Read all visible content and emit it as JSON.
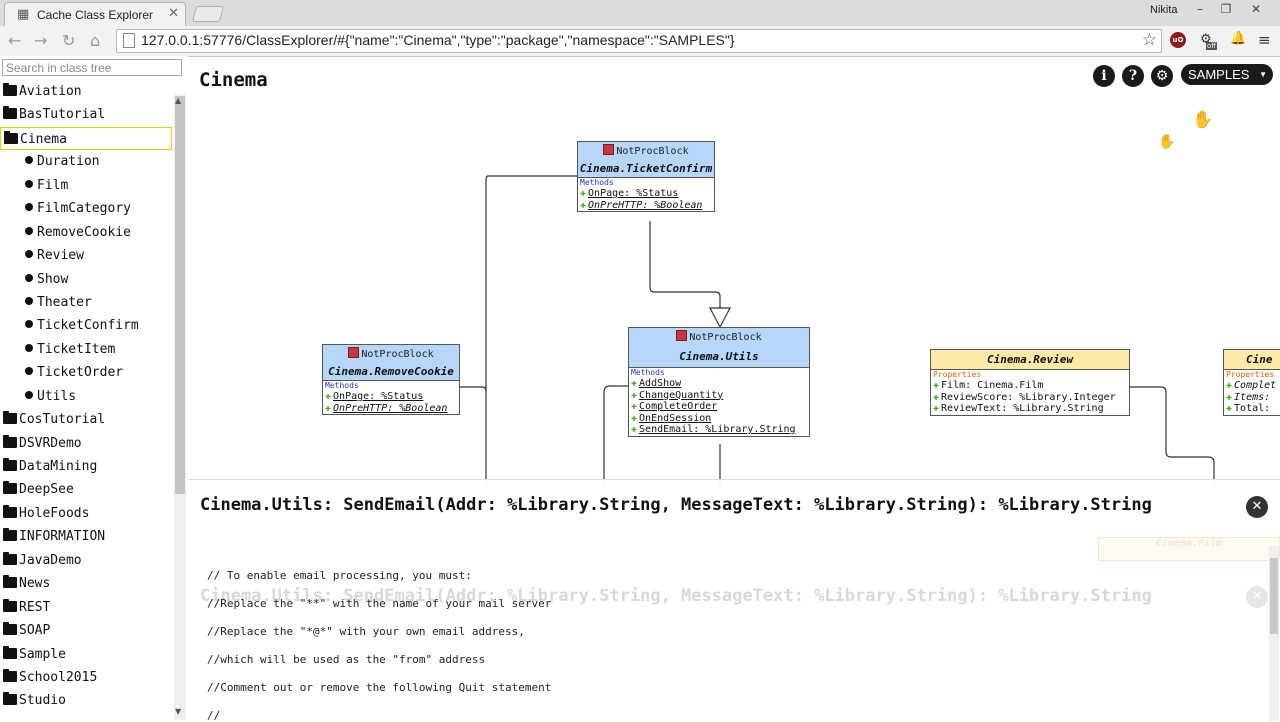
{
  "browser": {
    "tab_title": "Cache Class Explorer",
    "user_name": "Nikita",
    "url": "127.0.0.1:57776/ClassExplorer/#{\"name\":\"Cinema\",\"type\":\"package\",\"namespace\":\"SAMPLES\"}",
    "extensions": {
      "ublock_label": "uO",
      "off_badge": "off"
    },
    "icons": [
      "back-icon",
      "forward-icon",
      "reload-icon",
      "home-icon",
      "star-icon",
      "bell-icon",
      "menu-icon"
    ]
  },
  "sidebar": {
    "search_placeholder": "Search in class tree",
    "items": [
      {
        "label": "Aviation",
        "kind": "package"
      },
      {
        "label": "BasTutorial",
        "kind": "package"
      },
      {
        "label": "Cinema",
        "kind": "package",
        "selected": true
      },
      {
        "label": "Duration",
        "kind": "class"
      },
      {
        "label": "Film",
        "kind": "class"
      },
      {
        "label": "FilmCategory",
        "kind": "class"
      },
      {
        "label": "RemoveCookie",
        "kind": "class"
      },
      {
        "label": "Review",
        "kind": "class"
      },
      {
        "label": "Show",
        "kind": "class"
      },
      {
        "label": "Theater",
        "kind": "class"
      },
      {
        "label": "TicketConfirm",
        "kind": "class"
      },
      {
        "label": "TicketItem",
        "kind": "class"
      },
      {
        "label": "TicketOrder",
        "kind": "class"
      },
      {
        "label": "Utils",
        "kind": "class"
      },
      {
        "label": "CosTutorial",
        "kind": "package"
      },
      {
        "label": "DSVRDemo",
        "kind": "package"
      },
      {
        "label": "DataMining",
        "kind": "package"
      },
      {
        "label": "DeepSee",
        "kind": "package"
      },
      {
        "label": "HoleFoods",
        "kind": "package"
      },
      {
        "label": "INFORMATION",
        "kind": "package"
      },
      {
        "label": "JavaDemo",
        "kind": "package"
      },
      {
        "label": "News",
        "kind": "package"
      },
      {
        "label": "REST",
        "kind": "package"
      },
      {
        "label": "SOAP",
        "kind": "package"
      },
      {
        "label": "Sample",
        "kind": "package"
      },
      {
        "label": "School2015",
        "kind": "package"
      },
      {
        "label": "Studio",
        "kind": "package"
      }
    ]
  },
  "main": {
    "title": "Cinema",
    "info_label": "i",
    "help_label": "?",
    "namespace": "SAMPLES"
  },
  "diagram": {
    "ticket_confirm": {
      "stereotype": "NotProcBlock",
      "name": "Cinema.TicketConfirm",
      "section": "Methods",
      "rows": [
        "OnPage: %Status",
        "OnPreHTTP: %Boolean"
      ]
    },
    "remove_cookie": {
      "stereotype": "NotProcBlock",
      "name": "Cinema.RemoveCookie",
      "section": "Methods",
      "rows": [
        "OnPage: %Status",
        "OnPreHTTP: %Boolean"
      ]
    },
    "utils": {
      "stereotype": "NotProcBlock",
      "name": "Cinema.Utils",
      "section": "Methods",
      "rows": [
        "AddShow",
        "ChangeQuantity",
        "CompleteOrder",
        "OnEndSession",
        "SendEmail: %Library.String"
      ]
    },
    "review": {
      "name": "Cinema.Review",
      "section": "Properties",
      "rows": [
        "Film: Cinema.Film",
        "ReviewScore: %Library.Integer",
        "ReviewText: %Library.String"
      ]
    },
    "partial": {
      "name": "Cine",
      "section": "Properties",
      "rows": [
        "Complet",
        "Items:",
        "Total:"
      ]
    }
  },
  "popup": {
    "title": "Cinema.Utils: SendEmail(Addr: %Library.String, MessageText: %Library.String): %Library.String",
    "close_label": "✕",
    "ghost_box": "Cinema.Film",
    "code": [
      "// To enable email processing, you must:",
      "//Replace the \"**\" with the name of your mail server",
      "//Replace the \"*@*\" with your own email address,",
      "//which will be used as the \"from\" address",
      "//Comment out or remove the following Quit statement",
      "//"
    ]
  },
  "colors": {
    "class_header": "#b6d6fa",
    "persistent_header": "#fde9a8",
    "selected_border": "#e7d200",
    "methods_label": "#2233cc",
    "properties_label": "#e06000"
  }
}
